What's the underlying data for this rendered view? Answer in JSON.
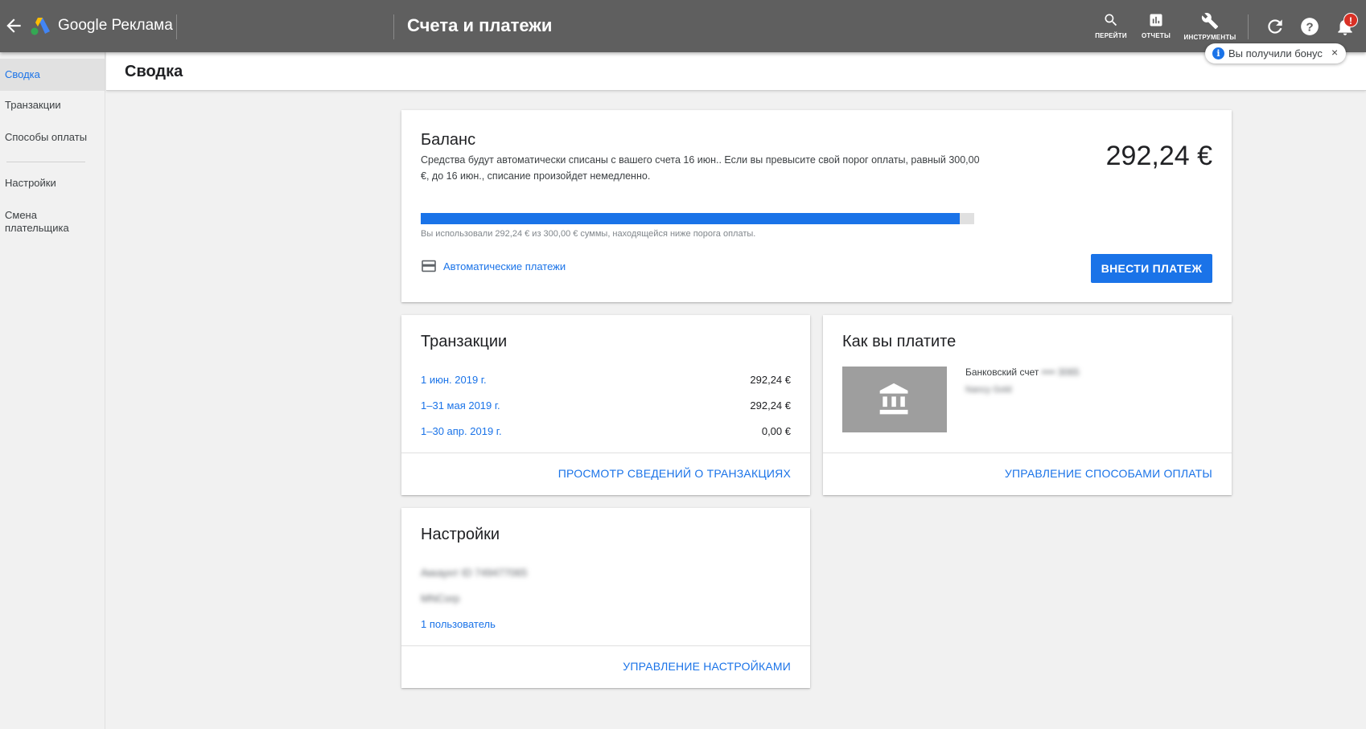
{
  "app": {
    "brand": "Google Реклама",
    "page_title": "Счета и платежи"
  },
  "toolbar": {
    "search_label": "ПЕРЕЙТИ",
    "reports_label": "ОТЧЕТЫ",
    "tools_label": "ИНСТРУМЕНТЫ",
    "notifications_badge": "!"
  },
  "toast": {
    "text": "Вы получили бонус",
    "close": "×"
  },
  "sidebar": {
    "items": [
      {
        "label": "Сводка",
        "active": true
      },
      {
        "label": "Транзакции"
      },
      {
        "label": "Способы оплаты"
      },
      {
        "label": "Настройки"
      },
      {
        "label": "Смена плательщика"
      }
    ]
  },
  "subheader": {
    "title": "Сводка"
  },
  "balance": {
    "title": "Баланс",
    "description": "Средства будут автоматически списаны с вашего счета 16 июн.. Если вы превысите свой порог оплаты, равный 300,00 €, до 16 июн., списание произойдет немедленно.",
    "amount": "292,24 €",
    "progress": 0.974,
    "progress_note": "Вы использовали 292,24 € из 300,00 € суммы, находящейся ниже порога оплаты.",
    "autopay_link": "Автоматические платежи",
    "pay_button": "ВНЕСТИ ПЛАТЕЖ"
  },
  "transactions": {
    "title": "Транзакции",
    "rows": [
      {
        "date": "1 июн. 2019 г.",
        "amount": "292,24 €"
      },
      {
        "date": "1–31 мая 2019 г.",
        "amount": "292,24 €"
      },
      {
        "date": "1–30 апр. 2019 г.",
        "amount": "0,00 €"
      }
    ],
    "footer_link": "ПРОСМОТР СВЕДЕНИЙ О ТРАНЗАКЦИЯХ"
  },
  "payment": {
    "title": "Как вы платите",
    "method_label": "Банковский счет",
    "method_number": "•••• 3065",
    "method_sub": "Nancy Gold",
    "footer_link": "УПРАВЛЕНИЕ СПОСОБАМИ ОПЛАТЫ"
  },
  "settings": {
    "title": "Настройки",
    "account_id": "Аккаунт ID 749477065",
    "company": "MNCorp",
    "users_link": "1 пользователь",
    "footer_link": "УПРАВЛЕНИЕ НАСТРОЙКАМИ"
  },
  "colors": {
    "accent": "#1a73e8",
    "topbar": "#5f5f5f",
    "badge": "#d93025"
  }
}
